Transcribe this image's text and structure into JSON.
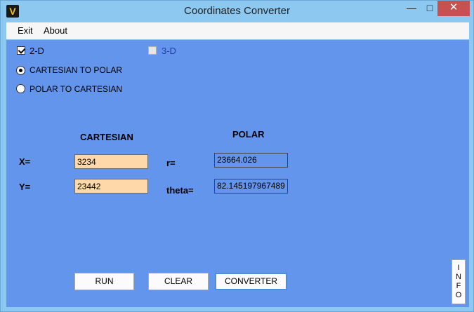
{
  "window": {
    "title": "Coordinates Converter",
    "icon_letter": "V",
    "minimize": "—",
    "maximize": "□",
    "close": "✕"
  },
  "menu": {
    "items": [
      {
        "label": "Exit"
      },
      {
        "label": "About"
      }
    ]
  },
  "options": {
    "dim_2d": {
      "label": "2-D",
      "checked": true
    },
    "dim_3d": {
      "label": "3-D",
      "checked": false,
      "enabled": false
    },
    "mode_cart_to_polar": {
      "label": "CARTESIAN TO POLAR",
      "selected": true
    },
    "mode_polar_to_cart": {
      "label": "POLAR TO CARTESIAN",
      "selected": false
    }
  },
  "cartesian": {
    "heading": "CARTESIAN",
    "x_label": "X=",
    "y_label": "Y=",
    "x_value": "3234",
    "y_value": "23442"
  },
  "polar": {
    "heading": "POLAR",
    "r_label": "r=",
    "theta_label": "theta=",
    "r_value": "23664.026",
    "theta_value": "82.145197967489"
  },
  "buttons": {
    "run": "RUN",
    "clear": "CLEAR",
    "converter": "CONVERTER",
    "info_letters": [
      "I",
      "N",
      "F",
      "O"
    ]
  },
  "colors": {
    "panel": "#6495ed",
    "input_bg": "#fed8a8",
    "frame": "#8cc8f0",
    "close": "#c75050"
  }
}
